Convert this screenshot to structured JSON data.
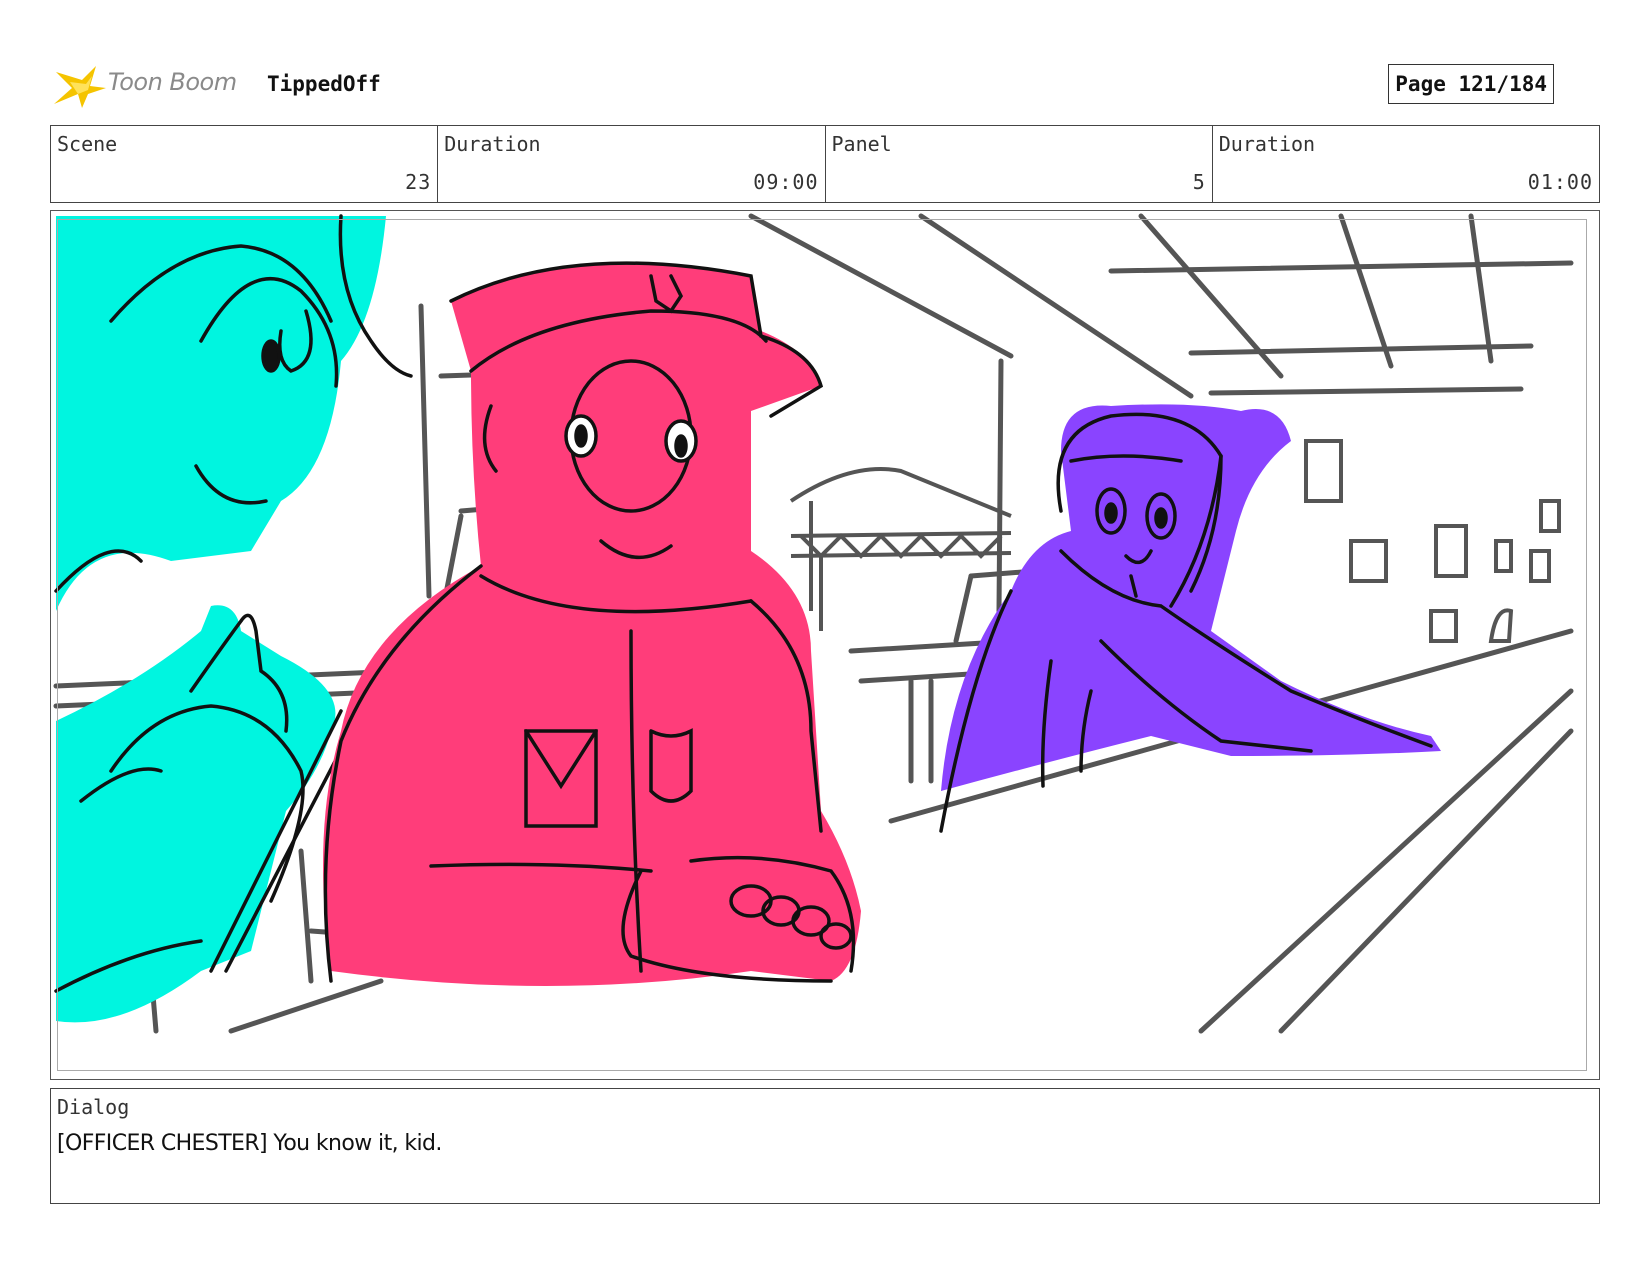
{
  "header": {
    "logo_text": "Toon Boom",
    "project_title": "TippedOff",
    "page_label": "Page 121/184"
  },
  "info": {
    "scene_label": "Scene",
    "scene_value": "23",
    "scene_duration_label": "Duration",
    "scene_duration_value": "09:00",
    "panel_label": "Panel",
    "panel_value": "5",
    "panel_duration_label": "Duration",
    "panel_duration_value": "01:00"
  },
  "dialog": {
    "label": "Dialog",
    "text": "[OFFICER CHESTER] You know it, kid."
  },
  "colors": {
    "cyan_character": "#00f5e0",
    "pink_character": "#ff3d7a",
    "purple_character": "#8a44ff",
    "line_art": "#111111",
    "background_lines": "#555555",
    "logo_star": "#f5c400"
  }
}
